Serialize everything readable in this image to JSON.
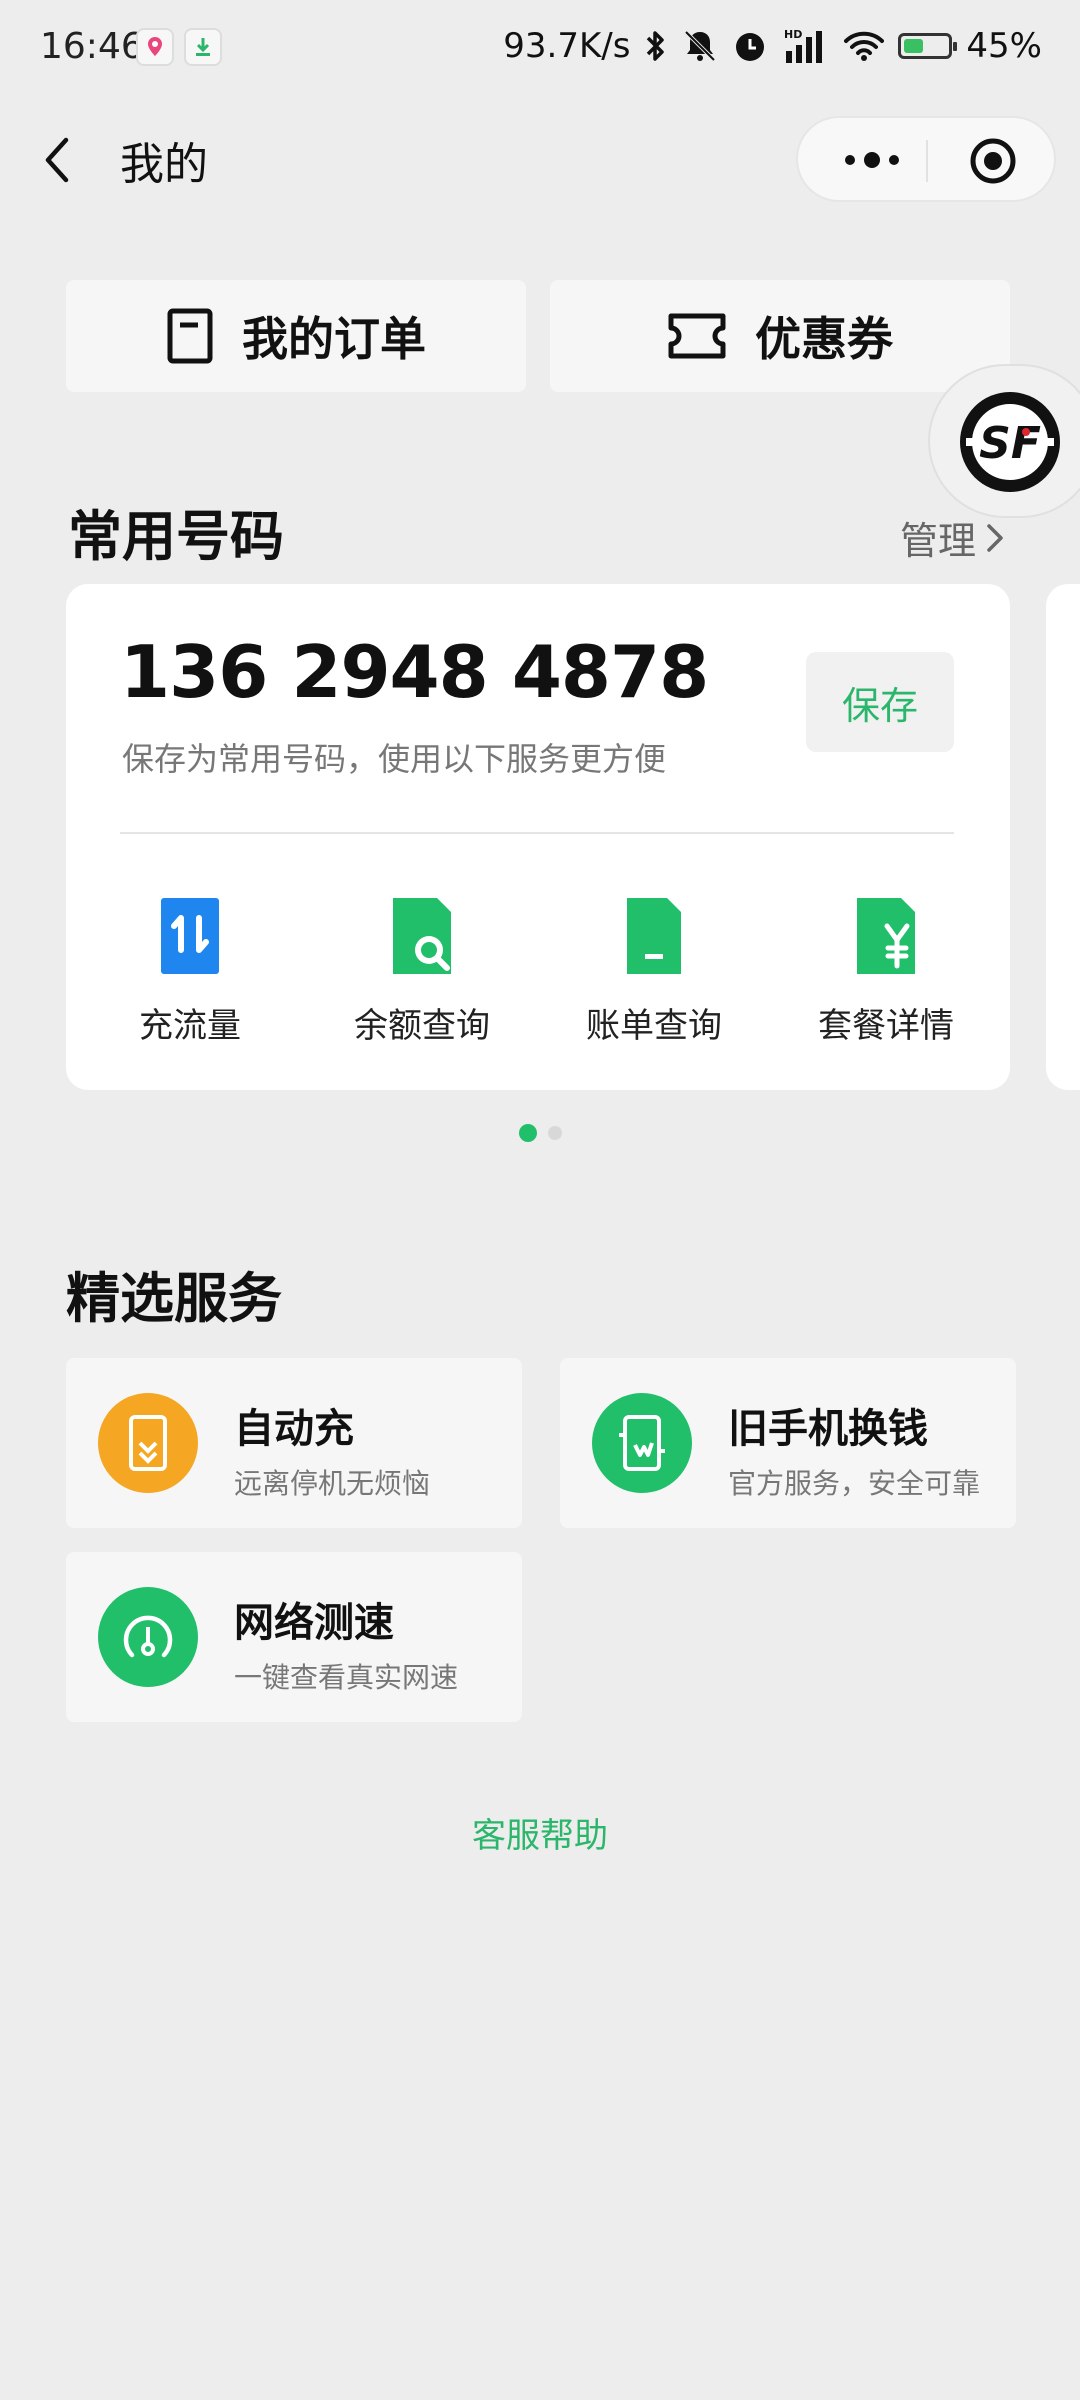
{
  "status_bar": {
    "time": "16:46",
    "speed": "93.7K/s",
    "battery": "45%",
    "battery_level": 0.45,
    "icons": [
      "location-app-icon",
      "download-icon",
      "bluetooth-icon",
      "mute-bell-icon",
      "alarm-icon",
      "hd-signal-icon",
      "wifi-icon",
      "battery-icon"
    ]
  },
  "header": {
    "title": "我的"
  },
  "top_buttons": {
    "orders": "我的订单",
    "coupons": "优惠券"
  },
  "common_numbers": {
    "title": "常用号码",
    "manage": "管理",
    "number": "136 2948 4878",
    "hint": "保存为常用号码，使用以下服务更方便",
    "save": "保存",
    "services": [
      {
        "label": "充流量",
        "icon": "data-topup-icon"
      },
      {
        "label": "余额查询",
        "icon": "balance-search-icon"
      },
      {
        "label": "账单查询",
        "icon": "bill-document-icon"
      },
      {
        "label": "套餐详情",
        "icon": "plan-yuan-icon"
      }
    ],
    "page_count": 2,
    "active_page": 1
  },
  "featured": {
    "title": "精选服务",
    "items": [
      {
        "title": "自动充",
        "subtitle": "远离停机无烦恼",
        "icon": "auto-recharge-icon",
        "color": "#f5a623"
      },
      {
        "title": "旧手机换钱",
        "subtitle": "官方服务，安全可靠",
        "icon": "phone-trade-in-icon",
        "color": "#22bf6b"
      },
      {
        "title": "网络测速",
        "subtitle": "一键查看真实网速",
        "icon": "speed-gauge-icon",
        "color": "#22bf6b"
      }
    ]
  },
  "help": "客服帮助",
  "colors": {
    "accent": "#2bb66b",
    "service_green": "#22bf6b",
    "service_blue": "#1f86f0",
    "orange": "#f5a623",
    "background": "#ededed"
  }
}
